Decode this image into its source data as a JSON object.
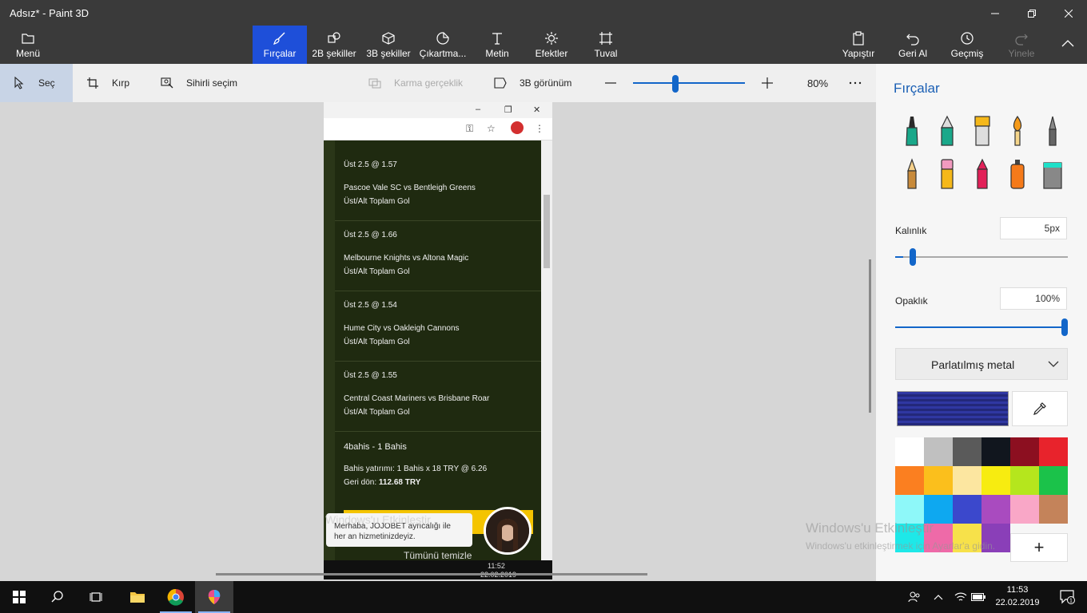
{
  "window": {
    "title": "Adsız* - Paint 3D"
  },
  "ribbon": {
    "menu": "Menü",
    "tabs": [
      "Fırçalar",
      "2B şekiller",
      "3B şekiller",
      "Çıkartma...",
      "Metin",
      "Efektler",
      "Tuval"
    ],
    "active_tab": "Fırçalar",
    "paste": "Yapıştır",
    "undo": "Geri Al",
    "history": "Geçmiş",
    "redo": "Yinele"
  },
  "toolbar": {
    "select": "Seç",
    "crop": "Kırp",
    "magic_select": "Sihirli seçim",
    "mixed_reality": "Karma gerçeklik",
    "view_3d": "3B görünüm",
    "zoom": "80%",
    "zoom_fraction": 0.38
  },
  "embedded_screenshot": {
    "bets": [
      {
        "line1": "Üst 2.5  @ 1.57",
        "match": "Pascoe Vale SC vs Bentleigh Greens",
        "market": "Üst/Alt Toplam Gol"
      },
      {
        "line1": "Üst 2.5  @ 1.66",
        "match": "Melbourne Knights vs Altona Magic",
        "market": "Üst/Alt Toplam Gol"
      },
      {
        "line1": "Üst 2.5  @ 1.54",
        "match": "Hume City vs Oakleigh Cannons",
        "market": "Üst/Alt Toplam Gol"
      },
      {
        "line1": "Üst 2.5  @ 1.55",
        "match": "Central Coast Mariners vs Brisbane Roar",
        "market": "Üst/Alt Toplam Gol"
      }
    ],
    "summary_title": "4bahis - 1 Bahis",
    "stake": "Bahis yatırımı:  1 Bahis x 18 TRY  @ 6.26",
    "return_label": "Geri dön:",
    "return_value": "112.68 TRY",
    "chat_message": "Merhaba, JOJOBET ayrıcalığı ile her an hizmetinizdeyiz.",
    "clear_all": "Tümünü temizle",
    "taskbar_time": "11:52",
    "taskbar_date": "22.02.2019"
  },
  "panel": {
    "title": "Fırçalar",
    "thickness_label": "Kalınlık",
    "thickness_value": "5px",
    "thickness_fraction": 0.05,
    "opacity_label": "Opaklık",
    "opacity_value": "100%",
    "opacity_fraction": 1.0,
    "finish": "Parlatılmış metal",
    "selected_color": "#2b3196",
    "palette": [
      "#ffffff",
      "#c0c0c0",
      "#5a5a5a",
      "#11161e",
      "#8c0f20",
      "#e8232c",
      "#fb7f20",
      "#fbbf1c",
      "#fce6a0",
      "#f7ec10",
      "#b5e61d",
      "#1bc24a",
      "#8ef8f9",
      "#0ea8f0",
      "#3b48cc",
      "#a94bbf",
      "#f9a7c7",
      "#c4835a",
      "#1ee8e8",
      "#ee6aa8",
      "#f7e14a",
      "#8a3fb8"
    ]
  },
  "watermark": {
    "title": "Windows'u Etkinleştir",
    "subtitle": "Windows'u etkinleştirmek için Ayarlar'a gidin."
  },
  "taskbar": {
    "time": "11:53",
    "date": "22.02.2019",
    "notifications": "1"
  }
}
